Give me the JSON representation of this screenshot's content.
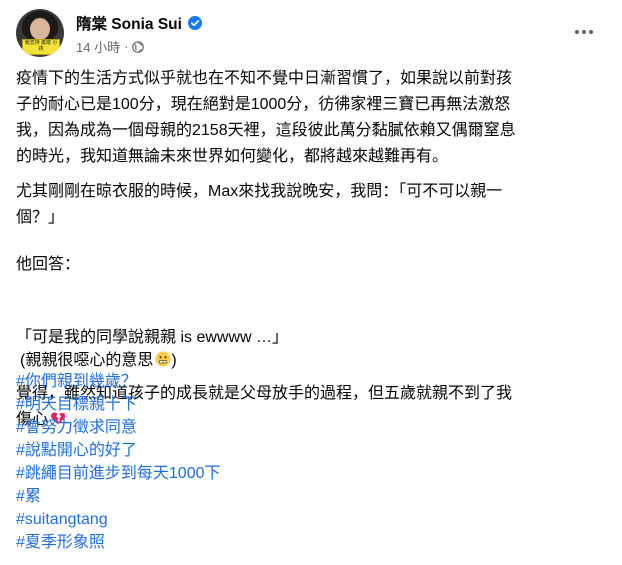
{
  "header": {
    "author": "隋棠 Sonia Sui",
    "time": "14 小時",
    "separator": "·",
    "avatar_sign_text": "我支持 勇敢 小孩"
  },
  "icons": {
    "verified": "verified-badge-icon",
    "privacy": "globe-icon",
    "more": "more-options-icon"
  },
  "post": {
    "p1": [
      "疫情下的生活方式似乎就也在不知不覺中日漸習慣了，如果說以前對孩",
      "子的耐心已是100分，現在絕對是1000分，彷彿家裡三寶已再無法激怒",
      "我，因為成為一個母親的2158天裡，這段彼此萬分黏膩依賴又偶爾窒息",
      "的時光，我知道無論未來世界如何變化，都將越來越難再有。"
    ],
    "p2": [
      "尤其剛剛在晾衣服的時候，Max來找我說晚安，我問：「可不可以親一",
      "個？」"
    ],
    "p3": "他回答：",
    "p4": "「可是我的同學說親親 is ewwww …」",
    "p5": "(親親很噁心的意思",
    "p6": [
      "覺得，雖然知道孩子的成長就是父母放手的過程，但五歲就親不到了我",
      "傷心"
    ]
  },
  "hashtags": [
    "#你們親到幾歲？",
    "#明天目標親十下",
    "#會努力徵求同意",
    "#說點開心的好了",
    "#跳繩目前進步到每天1000下",
    "#累",
    "#suitangtang",
    "#夏季形象照"
  ],
  "colors": {
    "link": "#216fdb",
    "secondary_text": "#65676b",
    "verified": "#1877f2",
    "broken_heart": "#e0245e",
    "emoji_face": "#ffcc4d"
  }
}
